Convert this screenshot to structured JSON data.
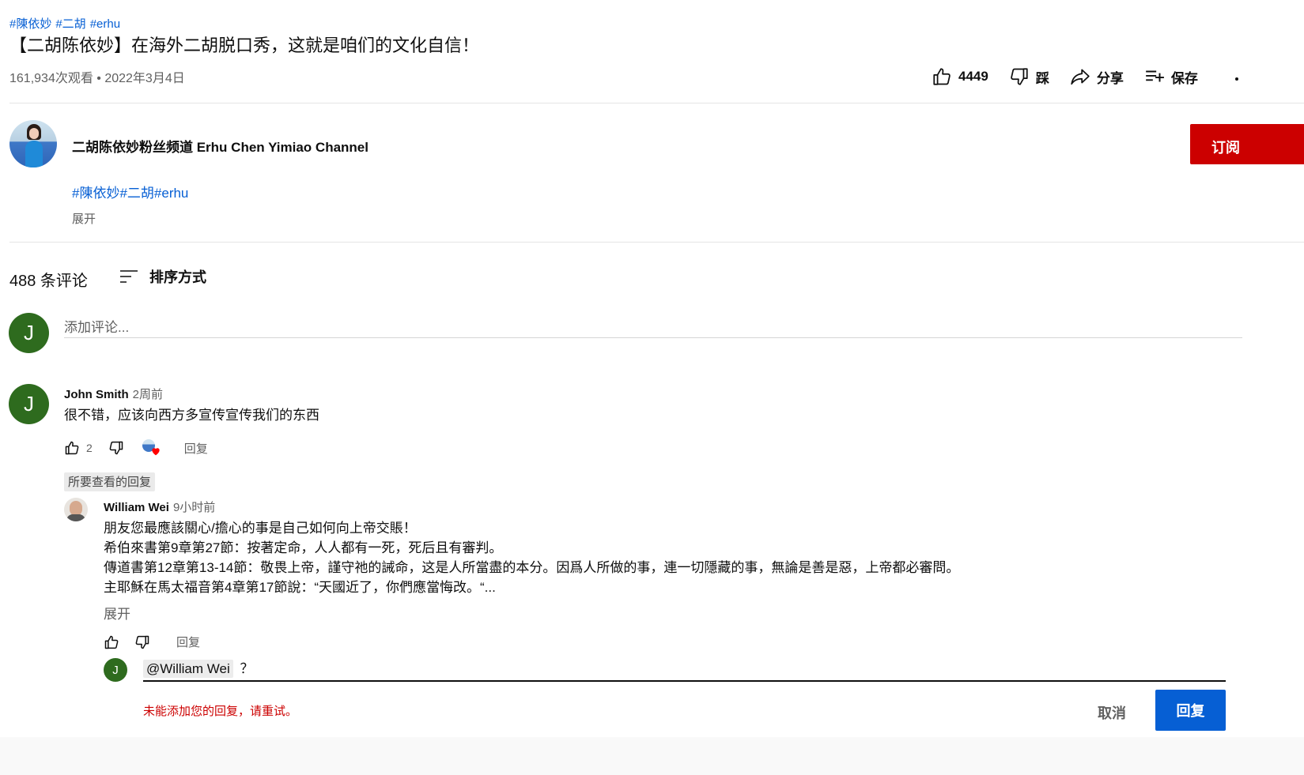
{
  "video": {
    "tags": [
      "#陳依妙",
      "#二胡",
      "#erhu"
    ],
    "title": "【二胡陈依妙】在海外二胡脱口秀，这就是咱们的文化自信！",
    "views_date": "161,934次观看 • 2022年3月4日"
  },
  "actions": {
    "like_count": "4449",
    "dislike_label": "踩",
    "share_label": "分享",
    "save_label": "保存"
  },
  "channel": {
    "name": "二胡陈依妙粉丝频道 Erhu Chen Yimiao Channel",
    "subscribe_label": "订阅"
  },
  "description": {
    "tags": "#陳依妙#二胡#erhu",
    "expand_label": "展开"
  },
  "comments_header": {
    "count_label": "488 条评论",
    "sort_label": "排序方式"
  },
  "add_comment": {
    "avatar_letter": "J",
    "placeholder": "添加评论..."
  },
  "comment": {
    "avatar_letter": "J",
    "author": "John Smith",
    "time": "2周前",
    "text": "很不错，应该向西方多宣传宣传我们的东西",
    "like_count": "2",
    "reply_label": "回复",
    "creator_hearted": true
  },
  "pinned_badge": "所要查看的回复",
  "reply": {
    "author": "William Wei",
    "time": "9小时前",
    "lines": [
      "朋友您最應該關心/擔心的事是自己如何向上帝交賬！",
      "希伯來書第9章第27節：按著定命，人人都有一死，死后且有審判。",
      "傳道書第12章第13-14節：敬畏上帝，謹守祂的誡命，这是人所當盡的本分。因爲人所做的事，連一切隱藏的事，無論是善是惡，上帝都必審問。",
      "主耶穌在馬太福音第4章第17節說：“天國近了，你們應當悔改。“..."
    ],
    "expand_label": "展开",
    "reply_label": "回复"
  },
  "reply_box": {
    "avatar_letter": "J",
    "mention": "@William Wei",
    "text": "？",
    "error": "未能添加您的回复，请重试。",
    "cancel_label": "取消",
    "submit_label": "回复"
  },
  "colors": {
    "link_blue": "#065fd4",
    "subscribe_red": "#cc0000",
    "avatar_green": "#2e6b1e",
    "error_red": "#cc0000"
  }
}
